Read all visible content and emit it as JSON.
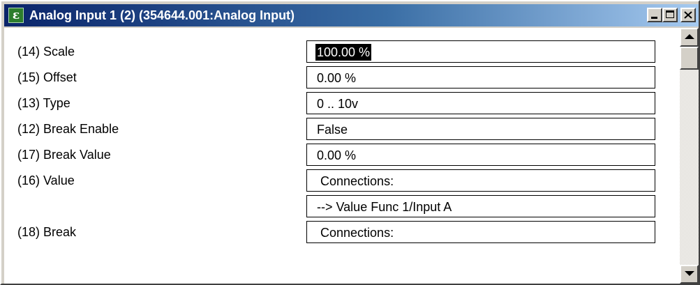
{
  "window": {
    "title": "Analog Input 1 (2) (354644.001:Analog Input)",
    "app_icon_glyph": "ε",
    "title_gradient": [
      "#0a246a",
      "#a6caf0"
    ]
  },
  "titlebar_buttons": {
    "minimize": "minimize-icon",
    "maximize": "maximize-icon",
    "close": "close-icon"
  },
  "rows": [
    {
      "label": "(14) Scale",
      "value": "100.00 %",
      "selected": true
    },
    {
      "label": "(15) Offset",
      "value": "0.00 %"
    },
    {
      "label": "(13) Type",
      "value": "0 .. 10v"
    },
    {
      "label": "(12) Break Enable",
      "value": "False"
    },
    {
      "label": "(17) Break Value",
      "value": "0.00 %"
    },
    {
      "label": "(16) Value",
      "value": " Connections:"
    },
    {
      "label": "",
      "value": "--> Value Func 1/Input A"
    },
    {
      "label": "(18) Break",
      "value": " Connections:"
    }
  ],
  "scrollbar": {
    "up_icon": "scroll-up-arrow-icon",
    "down_icon": "scroll-down-arrow-icon",
    "position_fraction": 0.0
  }
}
